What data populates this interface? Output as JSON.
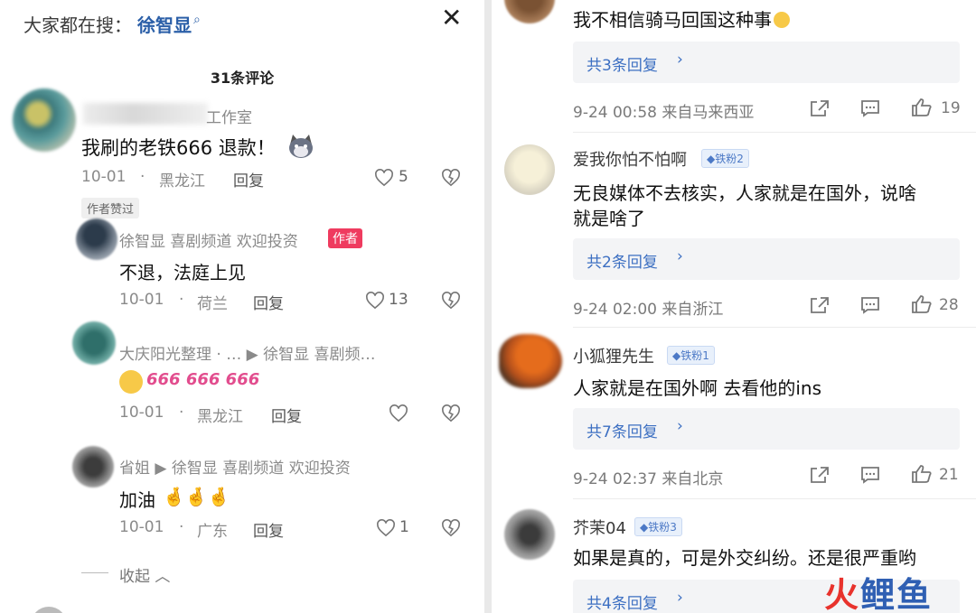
{
  "left": {
    "search_label": "大家都在搜：",
    "search_term": "徐智显",
    "comment_count": "31条评论",
    "main_comment": {
      "user_suffix": "工作室",
      "text": "我刷的老铁666 退款！",
      "date": "10-01",
      "location": "黑龙江",
      "reply": "回复",
      "likes": "5"
    },
    "liked_badge": "作者赞过",
    "replies": [
      {
        "user": "徐智显 喜剧频道 欢迎投资",
        "badge": "作者",
        "text": "不退，法庭上见",
        "date": "10-01",
        "location": "荷兰",
        "reply": "回复",
        "likes": "13"
      },
      {
        "user": "大庆阳光整理 · … ▶ 徐智显 喜剧频…",
        "text": "666 666 666",
        "date": "10-01",
        "location": "黑龙江",
        "reply": "回复",
        "likes": ""
      },
      {
        "user": "省姐 ▶ 徐智显 喜剧频道 欢迎投资",
        "text": "加油",
        "date": "10-01",
        "location": "广东",
        "reply": "回复",
        "likes": "1"
      }
    ],
    "collapse_label": "收起",
    "dot": "·"
  },
  "right": {
    "comments": [
      {
        "text": "我不相信骑马回国这种事",
        "replies_label": "共3条回复",
        "meta": "9-24 00:58 来自马来西亚",
        "likes": "19"
      },
      {
        "user": "爱我你怕不怕啊",
        "fan": "铁粉2",
        "text1": "无良媒体不去核实，人家就是在国外，说啥",
        "text2": "就是啥了",
        "replies_label": "共2条回复",
        "meta": "9-24 02:00 来自浙江",
        "likes": "28"
      },
      {
        "user": "小狐狸先生",
        "fan": "铁粉1",
        "text1": "人家就是在国外啊 去看他的ins",
        "replies_label": "共7条回复",
        "meta": "9-24 02:37 来自北京",
        "likes": "21"
      },
      {
        "user": "芥茉04",
        "fan": "铁粉3",
        "text1": "如果是真的，可是外交纠纷。还是很严重哟",
        "replies_label": "共4条回复"
      }
    ]
  },
  "watermark": {
    "part1": "火",
    "part2": "鲤鱼"
  },
  "colors": {
    "accent_blue": "#3c6fc2",
    "author_red": "#ef3b5f",
    "watermark_red": "#e8322c"
  }
}
